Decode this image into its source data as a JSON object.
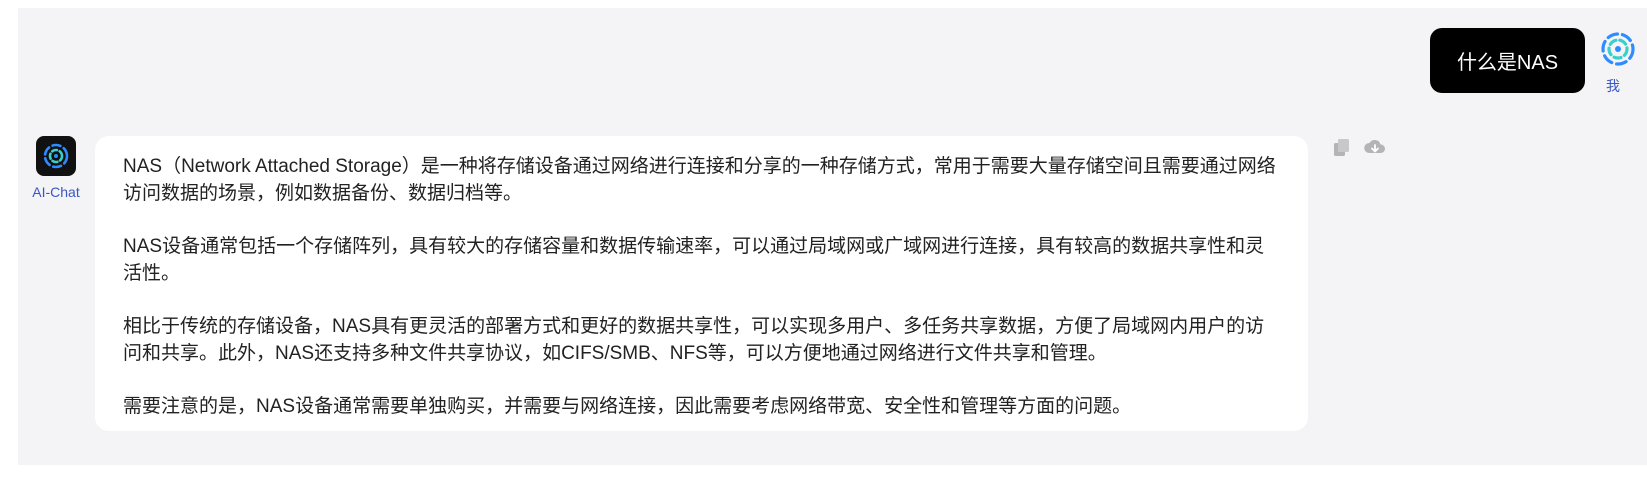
{
  "user_message": {
    "text": "什么是NAS",
    "name": "我",
    "avatar_icon": "chatgpt-logo-icon"
  },
  "ai_message": {
    "name": "AI-Chat",
    "avatar_icon": "chatgpt-logo-icon",
    "paragraphs": [
      "NAS（Network Attached Storage）是一种将存储设备通过网络进行连接和分享的一种存储方式，常用于需要大量存储空间且需要通过网络访问数据的场景，例如数据备份、数据归档等。",
      "NAS设备通常包括一个存储阵列，具有较大的存储容量和数据传输速率，可以通过局域网或广域网进行连接，具有较高的数据共享性和灵活性。",
      "相比于传统的存储设备，NAS具有更灵活的部署方式和更好的数据共享性，可以实现多用户、多任务共享数据，方便了局域网内用户的访问和共享。此外，NAS还支持多种文件共享协议，如CIFS/SMB、NFS等，可以方便地通过网络进行文件共享和管理。",
      "需要注意的是，NAS设备通常需要单独购买，并需要与网络连接，因此需要考虑网络带宽、安全性和管理等方面的问题。"
    ],
    "actions": [
      "copy-icon",
      "cloud-download-icon"
    ]
  },
  "colors": {
    "panel_bg": "#f4f4f6",
    "user_bubble_bg": "#000000",
    "name_label": "#3a56c4",
    "logo_blue": "#2f8cff",
    "logo_teal": "#38d0c8"
  }
}
